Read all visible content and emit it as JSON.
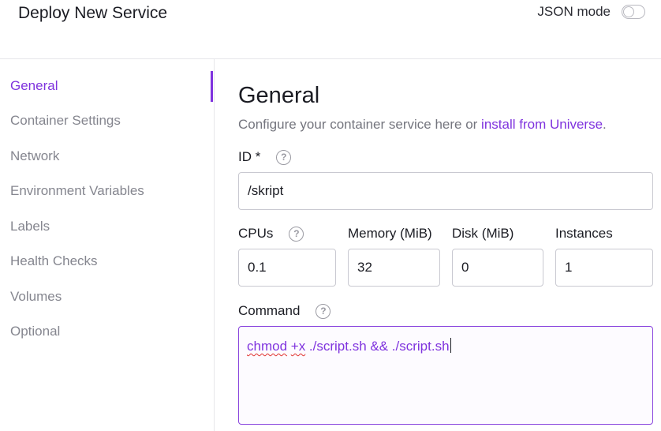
{
  "header": {
    "title": "Deploy New Service",
    "json_mode_label": "JSON mode",
    "json_mode_on": false
  },
  "sidebar": {
    "items": [
      {
        "label": "General",
        "active": true
      },
      {
        "label": "Container Settings"
      },
      {
        "label": "Network"
      },
      {
        "label": "Environment Variables"
      },
      {
        "label": "Labels"
      },
      {
        "label": "Health Checks"
      },
      {
        "label": "Volumes"
      },
      {
        "label": "Optional"
      }
    ]
  },
  "main": {
    "title": "General",
    "description": "Configure your container service here or ",
    "description_link": "install from Universe",
    "description_end": ".",
    "id_label": "ID *",
    "id_value": "/skript",
    "cpus_label": "CPUs",
    "cpus_value": "0.1",
    "memory_label": "Memory (MiB)",
    "memory_value": "32",
    "disk_label": "Disk (MiB)",
    "disk_value": "0",
    "instances_label": "Instances",
    "instances_value": "1",
    "command_label": "Command",
    "command_parts": [
      "chmod",
      " ",
      "+x",
      " ./script.sh && ./script.sh"
    ]
  },
  "icons": {
    "help": "help-circle-icon",
    "help_glyph": "?"
  },
  "colors": {
    "accent": "#7f33de",
    "muted_text": "#85868f",
    "border": "#c9c9d1",
    "spellcheck": "#e0312e"
  }
}
